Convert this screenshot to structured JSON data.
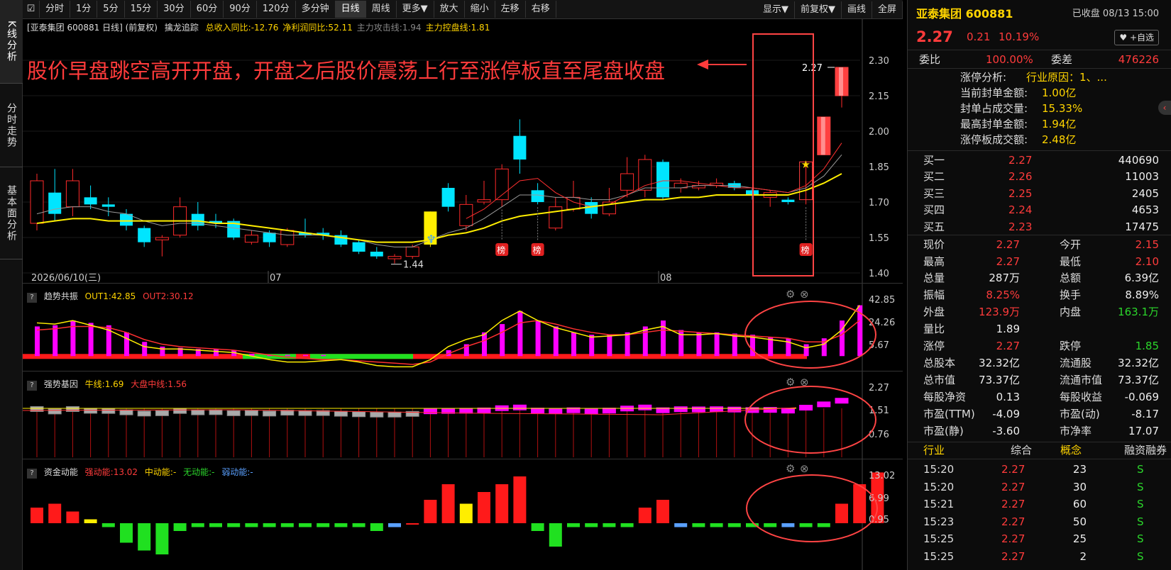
{
  "vtabs": [
    "K线分析",
    "分时走势",
    "基本面分析"
  ],
  "toolbar": {
    "items": [
      "分时",
      "1分",
      "5分",
      "15分",
      "30分",
      "60分",
      "90分",
      "120分",
      "多分钟",
      "日线",
      "周线",
      "更多▼",
      "放大",
      "缩小",
      "左移",
      "右移"
    ],
    "active": "日线",
    "right_items": [
      "显示▼",
      "前复权▼",
      "画线",
      "全屏"
    ]
  },
  "main": {
    "header_title": "[亚泰集团 600881 日线] (前复权)",
    "indicator_name": "擒龙追踪",
    "ind_values": [
      {
        "label": "总收入同比:-12.76",
        "color": "#ffd400"
      },
      {
        "label": "净利润同比:52.11",
        "color": "#ffd400"
      },
      {
        "label": "主力攻击线:1.94",
        "color": "#888888"
      },
      {
        "label": "主力控盘线:1.81",
        "color": "#ffd400"
      }
    ],
    "annotation": "股价早盘跳空高开开盘，开盘之后股价震荡上行至涨停板直至尾盘收盘",
    "price_ticks": [
      "2.30",
      "2.15",
      "2.00",
      "1.85",
      "1.70",
      "1.55",
      "1.40"
    ],
    "date_labels": [
      "2026/06/10(三)",
      "07",
      "08"
    ],
    "low_label": "1.44",
    "high_label": "2.27",
    "bang_label": "榜"
  },
  "panel2": {
    "name": "趋势共振",
    "out1": "OUT1:42.85",
    "out2": "OUT2:30.12",
    "ticks": [
      "42.85",
      "24.26",
      "5.67"
    ]
  },
  "panel3": {
    "name": "强势基因",
    "niu": "牛线:1.69",
    "dapan": "大盘中线:1.56",
    "ticks": [
      "2.27",
      "1.51",
      "0.76"
    ]
  },
  "panel4": {
    "name": "资金动能",
    "strong": "强动能:13.02",
    "mid": "中动能:-",
    "none": "无动能:-",
    "weak": "弱动能:-",
    "ticks": [
      "13.02",
      "6.99",
      "0.95"
    ]
  },
  "quote": {
    "name": "亚泰集团 600881",
    "status": "已收盘 08/13 15:00",
    "price": "2.27",
    "change": "0.21",
    "pct": "10.19%",
    "watch_btn": "+自选",
    "weibi_label": "委比",
    "weibi": "100.00%",
    "weicha_label": "委差",
    "weicha": "476226"
  },
  "limit": [
    {
      "label": "涨停分析:",
      "value": "行业原因：1、..."
    },
    {
      "label": "当前封单金额:",
      "value": "1.00亿"
    },
    {
      "label": "封单占成交量:",
      "value": "15.33%"
    },
    {
      "label": "最高封单金额:",
      "value": "1.94亿"
    },
    {
      "label": "涨停板成交额:",
      "value": "2.48亿"
    }
  ],
  "bids": [
    {
      "label": "买一",
      "price": "2.27",
      "vol": "440690"
    },
    {
      "label": "买二",
      "price": "2.26",
      "vol": "11003"
    },
    {
      "label": "买三",
      "price": "2.25",
      "vol": "2405"
    },
    {
      "label": "买四",
      "price": "2.24",
      "vol": "4653"
    },
    {
      "label": "买五",
      "price": "2.23",
      "vol": "17475"
    }
  ],
  "stats": [
    {
      "l1": "现价",
      "v1": "2.27",
      "c1": "red",
      "l2": "今开",
      "v2": "2.15",
      "c2": "red"
    },
    {
      "l1": "最高",
      "v1": "2.27",
      "c1": "red",
      "l2": "最低",
      "v2": "2.10",
      "c2": "red"
    },
    {
      "l1": "总量",
      "v1": "287万",
      "c1": "white",
      "l2": "总额",
      "v2": "6.39亿",
      "c2": "white"
    },
    {
      "l1": "振幅",
      "v1": "8.25%",
      "c1": "red",
      "l2": "换手",
      "v2": "8.89%",
      "c2": "white"
    },
    {
      "l1": "外盘",
      "v1": "123.9万",
      "c1": "red",
      "l2": "内盘",
      "v2": "163.1万",
      "c2": "green"
    },
    {
      "l1": "量比",
      "v1": "1.89",
      "c1": "white",
      "l2": "",
      "v2": "",
      "c2": "white"
    },
    {
      "l1": "涨停",
      "v1": "2.27",
      "c1": "red",
      "l2": "跌停",
      "v2": "1.85",
      "c2": "green"
    },
    {
      "l1": "总股本",
      "v1": "32.32亿",
      "c1": "white",
      "l2": "流通股",
      "v2": "32.32亿",
      "c2": "white"
    },
    {
      "l1": "总市值",
      "v1": "73.37亿",
      "c1": "white",
      "l2": "流通市值",
      "v2": "73.37亿",
      "c2": "white"
    },
    {
      "l1": "每股净资",
      "v1": "0.13",
      "c1": "white",
      "l2": "每股收益",
      "v2": "-0.069",
      "c2": "white"
    },
    {
      "l1": "市盈(TTM)",
      "v1": "-4.09",
      "c1": "white",
      "l2": "市盈(动)",
      "v2": "-8.17",
      "c2": "white"
    },
    {
      "l1": "市盈(静)",
      "v1": "-3.60",
      "c1": "white",
      "l2": "市净率",
      "v2": "17.07",
      "c2": "white"
    }
  ],
  "tabs": [
    "行业",
    "综合",
    "概念",
    "融资融券"
  ],
  "ticks": [
    {
      "time": "15:20",
      "price": "2.27",
      "vol": "23",
      "side": "S"
    },
    {
      "time": "15:20",
      "price": "2.27",
      "vol": "30",
      "side": "S"
    },
    {
      "time": "15:21",
      "price": "2.27",
      "vol": "60",
      "side": "S"
    },
    {
      "time": "15:23",
      "price": "2.27",
      "vol": "50",
      "side": "S"
    },
    {
      "time": "15:25",
      "price": "2.27",
      "vol": "25",
      "side": "S"
    },
    {
      "time": "15:25",
      "price": "2.27",
      "vol": "2",
      "side": "S"
    }
  ],
  "colors": {
    "up": "#ff2a2a",
    "down": "#00e5ff",
    "ma": "#ffee00",
    "magenta": "#ff00ff",
    "annotation": "#ff3b3b"
  },
  "chart_data": {
    "type": "candlestick",
    "title": "亚泰集团 600881 日线",
    "ylim": [
      1.4,
      2.3
    ],
    "candles": [
      {
        "o": 1.61,
        "c": 1.79,
        "h": 1.82,
        "l": 1.58
      },
      {
        "o": 1.74,
        "c": 1.65,
        "h": 1.84,
        "l": 1.62
      },
      {
        "o": 1.68,
        "c": 1.79,
        "h": 1.84,
        "l": 1.64
      },
      {
        "o": 1.72,
        "c": 1.69,
        "h": 1.77,
        "l": 1.67
      },
      {
        "o": 1.69,
        "c": 1.68,
        "h": 1.72,
        "l": 1.64
      },
      {
        "o": 1.65,
        "c": 1.6,
        "h": 1.67,
        "l": 1.58
      },
      {
        "o": 1.59,
        "c": 1.53,
        "h": 1.6,
        "l": 1.51
      },
      {
        "o": 1.54,
        "c": 1.55,
        "h": 1.56,
        "l": 1.47
      },
      {
        "o": 1.56,
        "c": 1.68,
        "h": 1.72,
        "l": 1.55
      },
      {
        "o": 1.65,
        "c": 1.6,
        "h": 1.7,
        "l": 1.58
      },
      {
        "o": 1.62,
        "c": 1.61,
        "h": 1.65,
        "l": 1.59
      },
      {
        "o": 1.62,
        "c": 1.55,
        "h": 1.63,
        "l": 1.54
      },
      {
        "o": 1.53,
        "c": 1.56,
        "h": 1.58,
        "l": 1.52
      },
      {
        "o": 1.57,
        "c": 1.53,
        "h": 1.58,
        "l": 1.51
      },
      {
        "o": 1.52,
        "c": 1.58,
        "h": 1.59,
        "l": 1.51
      },
      {
        "o": 1.57,
        "c": 1.56,
        "h": 1.63,
        "l": 1.55
      },
      {
        "o": 1.57,
        "c": 1.56,
        "h": 1.59,
        "l": 1.54
      },
      {
        "o": 1.56,
        "c": 1.52,
        "h": 1.58,
        "l": 1.51
      },
      {
        "o": 1.53,
        "c": 1.49,
        "h": 1.54,
        "l": 1.48
      },
      {
        "o": 1.49,
        "c": 1.47,
        "h": 1.51,
        "l": 1.46
      },
      {
        "o": 1.46,
        "c": 1.47,
        "h": 1.48,
        "l": 1.44
      },
      {
        "o": 1.47,
        "c": 1.51,
        "h": 1.52,
        "l": 1.46
      },
      {
        "o": 1.52,
        "c": 1.66,
        "h": 1.66,
        "l": 1.51
      },
      {
        "o": 1.76,
        "c": 1.68,
        "h": 1.78,
        "l": 1.66
      },
      {
        "o": 1.6,
        "c": 1.69,
        "h": 1.73,
        "l": 1.58
      },
      {
        "o": 1.7,
        "c": 1.71,
        "h": 1.79,
        "l": 1.69
      },
      {
        "o": 1.71,
        "c": 1.84,
        "h": 1.86,
        "l": 1.68
      },
      {
        "o": 1.98,
        "c": 1.88,
        "h": 2.05,
        "l": 1.82
      },
      {
        "o": 1.75,
        "c": 1.7,
        "h": 1.78,
        "l": 1.69
      },
      {
        "o": 1.59,
        "c": 1.68,
        "h": 1.72,
        "l": 1.58
      },
      {
        "o": 1.67,
        "c": 1.72,
        "h": 1.79,
        "l": 1.66
      },
      {
        "o": 1.7,
        "c": 1.65,
        "h": 1.72,
        "l": 1.63
      },
      {
        "o": 1.65,
        "c": 1.7,
        "h": 1.76,
        "l": 1.64
      },
      {
        "o": 1.75,
        "c": 1.82,
        "h": 1.89,
        "l": 1.72
      },
      {
        "o": 1.75,
        "c": 1.88,
        "h": 1.9,
        "l": 1.72
      },
      {
        "o": 1.87,
        "c": 1.72,
        "h": 1.88,
        "l": 1.71
      },
      {
        "o": 1.76,
        "c": 1.78,
        "h": 1.8,
        "l": 1.74
      },
      {
        "o": 1.76,
        "c": 1.77,
        "h": 1.79,
        "l": 1.75
      },
      {
        "o": 1.77,
        "c": 1.78,
        "h": 1.8,
        "l": 1.76
      },
      {
        "o": 1.78,
        "c": 1.76,
        "h": 1.79,
        "l": 1.75
      },
      {
        "o": 1.75,
        "c": 1.73,
        "h": 1.76,
        "l": 1.71
      },
      {
        "o": 1.72,
        "c": 1.74,
        "h": 1.75,
        "l": 1.68
      },
      {
        "o": 1.71,
        "c": 1.7,
        "h": 1.72,
        "l": 1.69
      },
      {
        "o": 1.71,
        "c": 1.87,
        "h": 1.87,
        "l": 1.69
      },
      {
        "o": 1.9,
        "c": 2.06,
        "h": 2.06,
        "l": 1.9
      },
      {
        "o": 2.15,
        "c": 2.27,
        "h": 2.27,
        "l": 2.1
      }
    ],
    "ma_yellow": [
      1.61,
      1.62,
      1.63,
      1.63,
      1.62,
      1.62,
      1.62,
      1.62,
      1.62,
      1.62,
      1.61,
      1.61,
      1.6,
      1.59,
      1.58,
      1.57,
      1.56,
      1.55,
      1.54,
      1.53,
      1.53,
      1.53,
      1.54,
      1.56,
      1.57,
      1.59,
      1.62,
      1.64,
      1.65,
      1.66,
      1.67,
      1.68,
      1.69,
      1.7,
      1.71,
      1.71,
      1.72,
      1.72,
      1.73,
      1.73,
      1.73,
      1.73,
      1.73,
      1.75,
      1.78,
      1.82
    ],
    "ma_gray": [
      1.65,
      1.67,
      1.68,
      1.68,
      1.66,
      1.65,
      1.62,
      1.6,
      1.61,
      1.61,
      1.6,
      1.59,
      1.58,
      1.57,
      1.56,
      1.56,
      1.56,
      1.55,
      1.54,
      1.52,
      1.51,
      1.51,
      1.54,
      1.57,
      1.59,
      1.63,
      1.68,
      1.73,
      1.73,
      1.72,
      1.72,
      1.71,
      1.71,
      1.73,
      1.76,
      1.76,
      1.76,
      1.77,
      1.77,
      1.77,
      1.76,
      1.75,
      1.74,
      1.76,
      1.81,
      1.9
    ],
    "ma_red": [
      null,
      null,
      null,
      null,
      null,
      null,
      null,
      null,
      null,
      null,
      null,
      null,
      null,
      null,
      null,
      null,
      null,
      null,
      null,
      null,
      null,
      null,
      null,
      null,
      1.63,
      1.67,
      1.73,
      1.79,
      1.8,
      1.74,
      1.7,
      1.68,
      1.69,
      1.73,
      1.77,
      1.79,
      1.79,
      1.78,
      1.77,
      1.76,
      1.76,
      1.75,
      1.74,
      1.77,
      1.84,
      1.95
    ],
    "trend_bars": [
      25,
      26,
      30,
      28,
      26,
      20,
      12,
      8,
      7,
      6,
      6,
      5,
      2,
      1,
      1,
      1,
      1,
      0,
      -3,
      -5,
      -6,
      -7,
      0,
      5,
      10,
      20,
      27,
      38,
      30,
      25,
      20,
      18,
      18,
      20,
      25,
      30,
      22,
      20,
      20,
      19,
      18,
      16,
      15,
      10,
      15,
      30,
      42.85
    ],
    "trend_line_yellow": [
      28,
      27,
      30,
      26,
      22,
      15,
      8,
      6,
      6,
      5,
      4,
      3,
      0,
      -3,
      -5,
      -5,
      -4,
      -3,
      -5,
      -8,
      -9,
      -9,
      -3,
      8,
      14,
      18,
      30,
      38,
      30,
      24,
      20,
      16,
      17,
      18,
      22,
      25,
      18,
      18,
      19,
      17,
      16,
      14,
      12,
      7,
      10,
      22,
      42.85
    ],
    "trend_line_red": [
      22,
      23,
      25,
      25,
      24,
      20,
      14,
      10,
      8,
      7,
      6,
      5,
      3,
      1,
      -1,
      -2,
      -3,
      -3,
      -4,
      -5,
      -6,
      -7,
      -5,
      2,
      8,
      13,
      20,
      28,
      30,
      27,
      23,
      20,
      18,
      18,
      20,
      22,
      21,
      20,
      19,
      18,
      17,
      16,
      15,
      12,
      12,
      18,
      30.12
    ],
    "strong_bars": [
      4,
      5,
      3,
      1,
      -1,
      -5,
      -7,
      -8,
      -2,
      -1,
      -1,
      -1,
      -1,
      -1,
      -1,
      -1,
      -1,
      -1,
      -1,
      -2,
      -1,
      0,
      6,
      10,
      5,
      8,
      10,
      12,
      -2,
      -6,
      -1,
      -1,
      -1,
      -1,
      4,
      6,
      -1,
      -1,
      -1,
      -1,
      -1,
      -1,
      -1,
      -1,
      -1,
      5,
      10,
      13.02
    ]
  }
}
